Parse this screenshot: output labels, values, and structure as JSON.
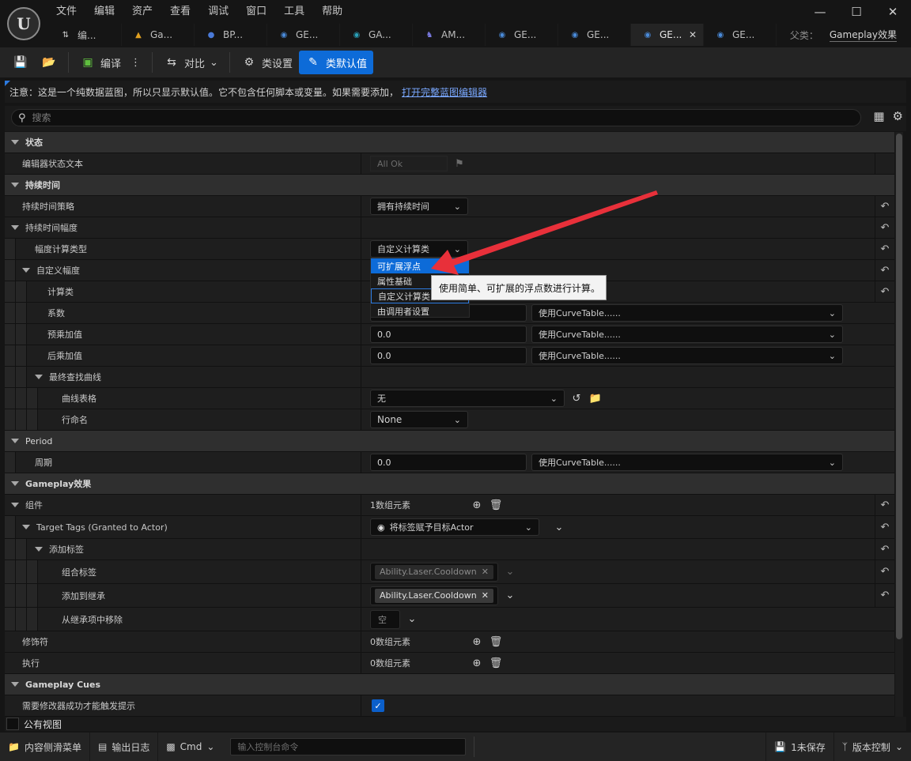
{
  "menu": [
    "文件",
    "编辑",
    "资产",
    "查看",
    "调试",
    "窗口",
    "工具",
    "帮助"
  ],
  "tabs": [
    {
      "label": "编...",
      "icon": "⇅",
      "color": "#cfcfcf"
    },
    {
      "label": "Ga...",
      "icon": "▲",
      "color": "#e0a020"
    },
    {
      "label": "BP...",
      "icon": "●",
      "color": "#4a7ad8"
    },
    {
      "label": "GE...",
      "icon": "◉",
      "color": "#4a8ad8"
    },
    {
      "label": "GA...",
      "icon": "◉",
      "color": "#2aa0b8"
    },
    {
      "label": "AM...",
      "icon": "♞",
      "color": "#7a7ae0"
    },
    {
      "label": "GE...",
      "icon": "◉",
      "color": "#4a8ad8"
    },
    {
      "label": "GE...",
      "icon": "◉",
      "color": "#4a8ad8"
    },
    {
      "label": "GE...",
      "icon": "◉",
      "color": "#4a8ad8",
      "active": true
    },
    {
      "label": "GE...",
      "icon": "◉",
      "color": "#4a8ad8"
    }
  ],
  "parent": {
    "label": "父类：",
    "value": "Gameplay效果"
  },
  "toolbar": {
    "compile": "编译",
    "diff": "对比",
    "class_settings": "类设置",
    "class_defaults": "类默认值"
  },
  "notice": {
    "text": "注意：这是一个纯数据蓝图，所以只显示默认值。它不包含任何脚本或变量。如果需要添加，",
    "link": "打开完整蓝图编辑器"
  },
  "search": {
    "placeholder": "搜索"
  },
  "rows": {
    "status_cat": "状态",
    "editor_status": "编辑器状态文本",
    "editor_status_val": "All Ok",
    "duration_cat": "持续时间",
    "duration_policy": "持续时间策略",
    "duration_policy_val": "拥有持续时间",
    "duration_mag": "持续时间幅度",
    "mag_calc_type": "幅度计算类型",
    "mag_calc_type_val": "自定义计算类",
    "custom_mag": "自定义幅度",
    "calc_class": "计算类",
    "coefficient": "系数",
    "pre_mult": "预乘加值",
    "pre_mult_val": "0.0",
    "post_mult": "后乘加值",
    "post_mult_val": "0.0",
    "curve_table_combo": "使用CurveTable......",
    "final_curve": "最终查找曲线",
    "curve_table": "曲线表格",
    "curve_table_val": "无",
    "row_name": "行命名",
    "row_name_val": "None",
    "period_cat": "Period",
    "period": "周期",
    "period_val": "0.0",
    "ge_cat": "Gameplay效果",
    "components": "组件",
    "components_val": "1数组元素",
    "target_tags": "Target Tags (Granted to Actor)",
    "target_tags_val": "将标签赋予目标Actor",
    "add_tags": "添加标签",
    "combined_tags": "组合标签",
    "combined_tags_val": "Ability.Laser.Cooldown",
    "add_inherited": "添加到继承",
    "add_inherited_val": "Ability.Laser.Cooldown",
    "remove_inherited": "从继承项中移除",
    "remove_inherited_val": "空",
    "modifiers": "修饰符",
    "modifiers_val": "0数组元素",
    "executions": "执行",
    "executions_val": "0数组元素",
    "cues_cat": "Gameplay Cues",
    "require_success": "需要修改器成功才能触发提示"
  },
  "dropdown": {
    "options": [
      "可扩展浮点",
      "属性基础",
      "自定义计算类",
      "由调用者设置"
    ],
    "tooltip": "使用简单、可扩展的浮点数进行计算。"
  },
  "footer": {
    "public_view": "公有视图",
    "content_drawer": "内容侧滑菜单",
    "output_log": "输出日志",
    "cmd": "Cmd",
    "cmd_placeholder": "输入控制台命令",
    "unsaved": "1未保存",
    "source_control": "版本控制"
  },
  "colors": {
    "accent": "#0d6bd8",
    "annotation_arrow": "#e8303a"
  }
}
